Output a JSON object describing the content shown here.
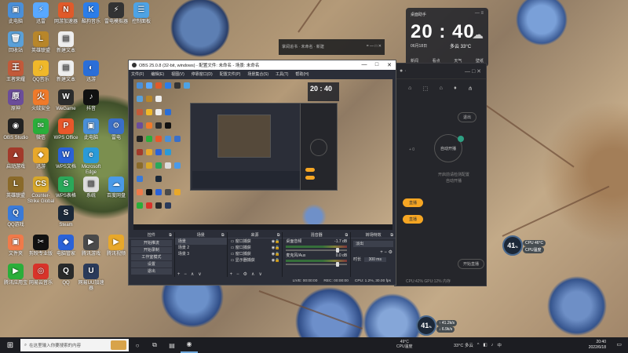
{
  "desktop": {
    "icons": [
      {
        "label": "此电脑",
        "color": "#4a8fd8",
        "glyph": "▣",
        "col": 0,
        "row": 0
      },
      {
        "label": "迅雷",
        "color": "#58a8ff",
        "glyph": "⚡",
        "col": 1,
        "row": 0
      },
      {
        "label": "网游加速器",
        "color": "#e05a2a",
        "glyph": "N",
        "col": 2,
        "row": 0
      },
      {
        "label": "酷狗音乐",
        "color": "#2b7de9",
        "glyph": "K",
        "col": 3,
        "row": 0
      },
      {
        "label": "雷电模拟器",
        "color": "#333",
        "glyph": "⚡",
        "col": 4,
        "row": 0
      },
      {
        "label": "控制面板",
        "color": "#4ea3e5",
        "glyph": "☰",
        "col": 5,
        "row": 0
      },
      {
        "label": "回收站",
        "color": "#5aa0d8",
        "glyph": "🗑",
        "col": 0,
        "row": 1
      },
      {
        "label": "英雄联盟",
        "color": "#b8862a",
        "glyph": "L",
        "col": 1,
        "row": 1
      },
      {
        "label": "新建文本",
        "color": "#eee",
        "glyph": "▤",
        "col": 2,
        "row": 1
      },
      {
        "label": "王者荣耀",
        "color": "#c25a3a",
        "glyph": "王",
        "col": 0,
        "row": 2
      },
      {
        "label": "QQ音乐",
        "color": "#f0b82a",
        "glyph": "♪",
        "col": 1,
        "row": 2
      },
      {
        "label": "新建文本",
        "color": "#eee",
        "glyph": "▤",
        "col": 2,
        "row": 2
      },
      {
        "label": "迅游",
        "color": "#2a6ed8",
        "glyph": "◐",
        "col": 3,
        "row": 2
      },
      {
        "label": "原神",
        "color": "#6b4d9a",
        "glyph": "原",
        "col": 0,
        "row": 3
      },
      {
        "label": "火绒安全",
        "color": "#f07a2a",
        "glyph": "火",
        "col": 1,
        "row": 3
      },
      {
        "label": "WeGame",
        "color": "#2c2c2c",
        "glyph": "W",
        "col": 2,
        "row": 3
      },
      {
        "label": "抖音",
        "color": "#111",
        "glyph": "♪",
        "col": 3,
        "row": 3
      },
      {
        "label": "OBS Studio",
        "color": "#222",
        "glyph": "◉",
        "col": 0,
        "row": 4
      },
      {
        "label": "微信",
        "color": "#2aae3a",
        "glyph": "✉",
        "col": 1,
        "row": 4
      },
      {
        "label": "WPS Office",
        "color": "#e8572a",
        "glyph": "P",
        "col": 2,
        "row": 4
      },
      {
        "label": "此电脑",
        "color": "#4a8fd8",
        "glyph": "▣",
        "col": 3,
        "row": 4
      },
      {
        "label": "雷电",
        "color": "#3a6fc8",
        "glyph": "⚙",
        "col": 4,
        "row": 4
      },
      {
        "label": "启动游戏",
        "color": "#a23a2a",
        "glyph": "▲",
        "col": 0,
        "row": 5
      },
      {
        "label": "迅游",
        "color": "#e8a82a",
        "glyph": "◆",
        "col": 1,
        "row": 5
      },
      {
        "label": "WPS文档",
        "color": "#2a62d8",
        "glyph": "W",
        "col": 2,
        "row": 5
      },
      {
        "label": "Microsoft Edge",
        "color": "#2a9ad8",
        "glyph": "e",
        "col": 3,
        "row": 5
      },
      {
        "label": "英雄联盟",
        "color": "#8a6a2a",
        "glyph": "L",
        "col": 0,
        "row": 6
      },
      {
        "label": "Counter-Strike Global",
        "color": "#d8a82a",
        "glyph": "CS",
        "col": 1,
        "row": 6
      },
      {
        "label": "WPS表格",
        "color": "#2aa85a",
        "glyph": "S",
        "col": 2,
        "row": 6
      },
      {
        "label": "系统",
        "color": "#ddd",
        "glyph": "▧",
        "col": 3,
        "row": 6
      },
      {
        "label": "百度网盘",
        "color": "#4a9ae8",
        "glyph": "☁",
        "col": 4,
        "row": 6
      },
      {
        "label": "QQ游戏",
        "color": "#3a7ad8",
        "glyph": "Q",
        "col": 0,
        "row": 7
      },
      {
        "label": "Steam",
        "color": "#1b2838",
        "glyph": "S",
        "col": 2,
        "row": 7
      },
      {
        "label": "文件夹",
        "color": "#f07a4a",
        "glyph": "▣",
        "col": 0,
        "row": 8
      },
      {
        "label": "剪映专业版",
        "color": "#111",
        "glyph": "✂",
        "col": 1,
        "row": 8
      },
      {
        "label": "电脑管家",
        "color": "#2a62d8",
        "glyph": "◆",
        "col": 2,
        "row": 8
      },
      {
        "label": "腾讯游戏",
        "color": "#4a4a4a",
        "glyph": "▶",
        "col": 3,
        "row": 8
      },
      {
        "label": "腾讯视频",
        "color": "#e8a82a",
        "glyph": "▶",
        "col": 4,
        "row": 8
      },
      {
        "label": "腾讯应用宝",
        "color": "#2aae3a",
        "glyph": "▶",
        "col": 0,
        "row": 9
      },
      {
        "label": "网易云音乐",
        "color": "#d8332a",
        "glyph": "◎",
        "col": 1,
        "row": 9
      },
      {
        "label": "QQ",
        "color": "#2a2a2a",
        "glyph": "Q",
        "col": 2,
        "row": 9
      },
      {
        "label": "网易UU加速器",
        "color": "#2a3a5a",
        "glyph": "U",
        "col": 3,
        "row": 9
      }
    ]
  },
  "widget": {
    "title": "桌面助手",
    "time": "20 : 40",
    "date": "06月18日",
    "weather": "多云 33°C",
    "cloud": "☁",
    "menu": "— ≡",
    "items": [
      "新闻",
      "看点",
      "天气",
      "壁纸"
    ]
  },
  "bg_window": {
    "title": "掌阅追书 · 未命名 · 新建",
    "controls": "= — □ ✕"
  },
  "side_app": {
    "top_left": "● ·",
    "top_right": "— □ ✕",
    "icons": [
      "⌂",
      "⬚",
      "⌂",
      "♦",
      "⋔"
    ],
    "exit_label": "退出",
    "mode_label": "自动开播",
    "plus_label": "+ 0",
    "hint_text": "开启前请检测配置",
    "hint_sub": "自动开播",
    "orange_1": "直播",
    "orange_2": "直播",
    "bottom_btn": "开始直播",
    "footer": "CPU:42%  GPU:12%  内存"
  },
  "gauges": {
    "mid": {
      "value": "41",
      "unit": "%",
      "label": "CPU 46°C",
      "sub": "CPU温度"
    },
    "bottom": {
      "value": "41",
      "unit": "%",
      "up": "↑ 41.2k/s",
      "down": "↓ 6.9k/s"
    }
  },
  "obs": {
    "title": "OBS 25.0.8 (32-bit, windows) - 配置文件: 未命名 - 场景: 未命名",
    "controls": [
      "—",
      "□",
      "✕"
    ],
    "menu": [
      "文件(F)",
      "编辑(E)",
      "视图(V)",
      "停靠窗口(D)",
      "配置文件(P)",
      "场景集合(S)",
      "工具(T)",
      "帮助(H)"
    ],
    "docks": {
      "controls": {
        "title": "控件",
        "buttons": [
          "开始推流",
          "开始录制",
          "工作室模式",
          "设置",
          "退出"
        ]
      },
      "scenes": {
        "title": "场景",
        "items": [
          "场景",
          "场景 2",
          "场景 3"
        ]
      },
      "sources": {
        "title": "来源",
        "items": [
          "窗口捕获",
          "窗口捕获",
          "窗口捕获",
          "显示器捕获"
        ]
      },
      "mixer": {
        "title": "混音器",
        "tracks": [
          {
            "name": "桌面音频",
            "db": "-1.7 dB"
          },
          {
            "name": "麦克风/Aux",
            "db": "0.0 dB"
          }
        ]
      },
      "transitions": {
        "title": "转场特效",
        "type": "淡出",
        "duration_label": "时长",
        "duration": "300 ms"
      }
    },
    "status": {
      "live": "LIVE: 00:00:00",
      "rec": "REC: 00:00:00",
      "cpu": "CPU: 1.2%, 30.00 fps"
    }
  },
  "taskbar": {
    "start": "⊞",
    "search_placeholder": "在这里输入你要搜索的内容",
    "apps": [
      "○",
      "⧉",
      "▤",
      "◉"
    ],
    "cpu_temp": "49°C",
    "cpu_label": "CPU温度",
    "weather": "33°C 多云",
    "tray_icons": [
      "^",
      "◧",
      "♪",
      "中"
    ],
    "time": "20:40",
    "date": "2022/6/18",
    "notif": "▭"
  }
}
